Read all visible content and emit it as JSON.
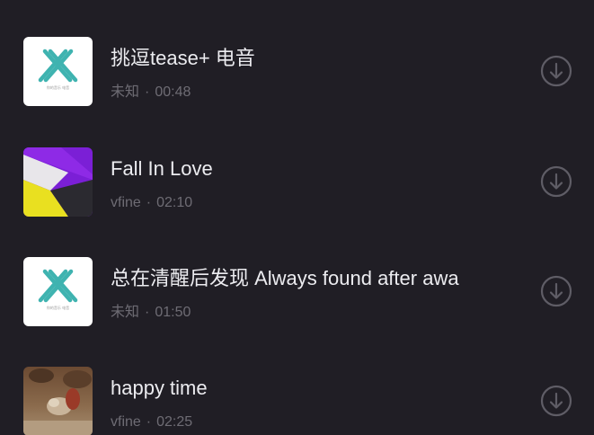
{
  "songs": [
    {
      "title": "挑逗tease+ 电音",
      "artist": "未知",
      "separator": "·",
      "duration": "00:48",
      "cover_icon": "x-logo-cover",
      "cover_text": "你的音乐 电音",
      "download_icon": "download-circle-icon"
    },
    {
      "title": "Fall In Love",
      "artist": "vfine",
      "separator": "·",
      "duration": "02:10",
      "cover_icon": "abstract-purple-yellow-cover",
      "download_icon": "download-circle-icon"
    },
    {
      "title": "总在清醒后发现 Always found after awa",
      "artist": "未知",
      "separator": "·",
      "duration": "01:50",
      "cover_icon": "x-logo-cover",
      "cover_text": "你的音乐 电音",
      "download_icon": "download-circle-icon"
    },
    {
      "title": "happy time",
      "artist": "vfine",
      "separator": "·",
      "duration": "02:25",
      "cover_icon": "photo-dog-cover",
      "download_icon": "download-circle-icon"
    }
  ],
  "colors": {
    "background": "#201e25",
    "title_text": "#ececf0",
    "meta_text": "#6e6c74",
    "download_icon": "#5f5d66",
    "logo_teal": "#3fb3b0"
  }
}
